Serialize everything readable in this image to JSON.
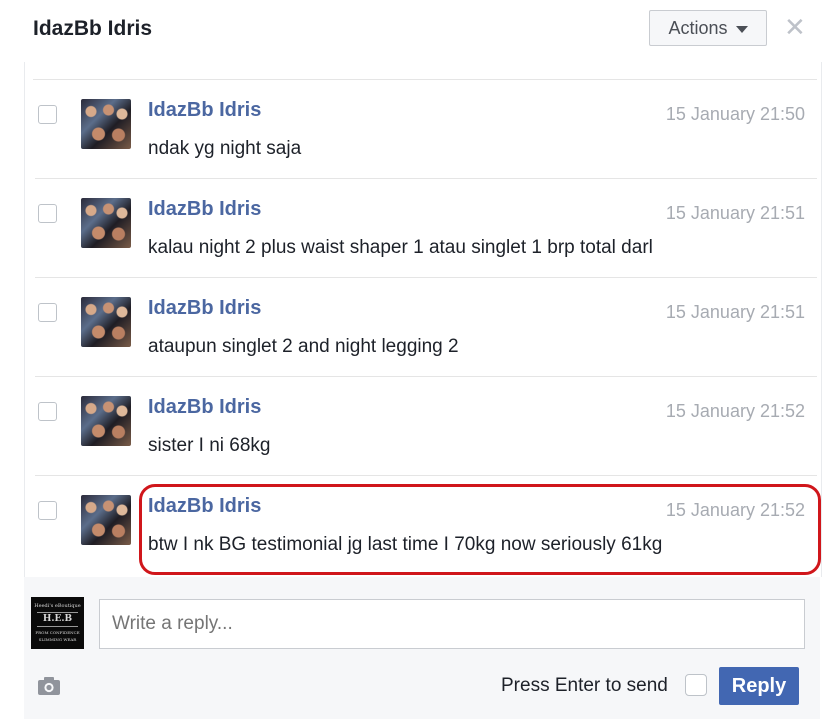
{
  "header": {
    "title": "IdazBb Idris",
    "actions_label": "Actions",
    "close_label": "✕"
  },
  "messages": [
    {
      "sender": "IdazBb Idris",
      "time": "15 January 21:50",
      "text": "ndak yg night saja"
    },
    {
      "sender": "IdazBb Idris",
      "time": "15 January 21:51",
      "text": "kalau night 2 plus waist shaper 1 atau singlet 1 brp total darl"
    },
    {
      "sender": "IdazBb Idris",
      "time": "15 January 21:51",
      "text": "ataupun singlet 2 and night legging 2"
    },
    {
      "sender": "IdazBb Idris",
      "time": "15 January 21:52",
      "text": "sister I ni 68kg"
    },
    {
      "sender": "IdazBb Idris",
      "time": "15 January 21:52",
      "text": "btw I nk BG testimonial jg last time I 70kg now seriously 61kg"
    }
  ],
  "reply": {
    "placeholder": "Write a reply...",
    "press_enter_label": "Press Enter to send",
    "reply_button": "Reply",
    "page_avatar_lines": [
      "Heedi's eBoutique",
      "H.E.B",
      "FROM CONFIDENCE",
      "SLIMMING WEAR"
    ]
  },
  "colors": {
    "link": "#4b67a1",
    "button": "#4267b2",
    "highlight": "#d0161b"
  }
}
